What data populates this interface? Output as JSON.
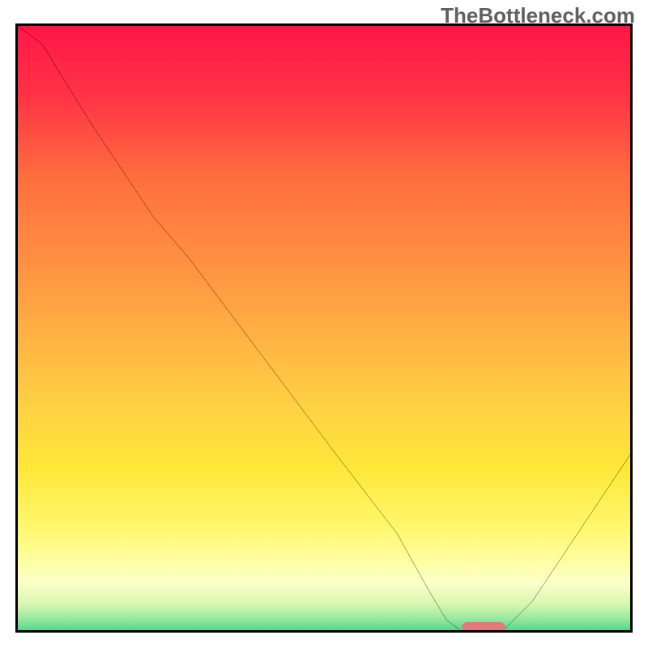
{
  "watermark": "TheBottleneck.com",
  "colors": {
    "gradient_stops": [
      {
        "offset": 0.0,
        "color": "#ff1646"
      },
      {
        "offset": 0.12,
        "color": "#ff3545"
      },
      {
        "offset": 0.25,
        "color": "#ff6f3e"
      },
      {
        "offset": 0.38,
        "color": "#ff8f42"
      },
      {
        "offset": 0.5,
        "color": "#ffb043"
      },
      {
        "offset": 0.62,
        "color": "#ffd143"
      },
      {
        "offset": 0.72,
        "color": "#ffe738"
      },
      {
        "offset": 0.82,
        "color": "#fff86d"
      },
      {
        "offset": 0.88,
        "color": "#ffffa7"
      },
      {
        "offset": 0.91,
        "color": "#fcffc9"
      },
      {
        "offset": 0.945,
        "color": "#d7f6af"
      },
      {
        "offset": 0.97,
        "color": "#92e79d"
      },
      {
        "offset": 0.985,
        "color": "#5ad98e"
      },
      {
        "offset": 1.0,
        "color": "#28c97f"
      }
    ],
    "curve": "#000000",
    "marker": "#e17a7d",
    "frame": "#000000"
  },
  "chart_data": {
    "type": "line",
    "title": "",
    "xlabel": "",
    "ylabel": "",
    "xlim": [
      0,
      100
    ],
    "ylim": [
      0,
      100
    ],
    "grid": false,
    "legend": false,
    "x": [
      0,
      4,
      12,
      22,
      28,
      40,
      52,
      62,
      67,
      70,
      74,
      78,
      84,
      92,
      100
    ],
    "values": [
      100,
      97,
      84,
      69,
      62,
      46,
      30,
      17,
      8,
      3,
      0,
      0,
      6,
      18,
      30
    ],
    "marker": {
      "x": 76,
      "y": 0
    }
  }
}
